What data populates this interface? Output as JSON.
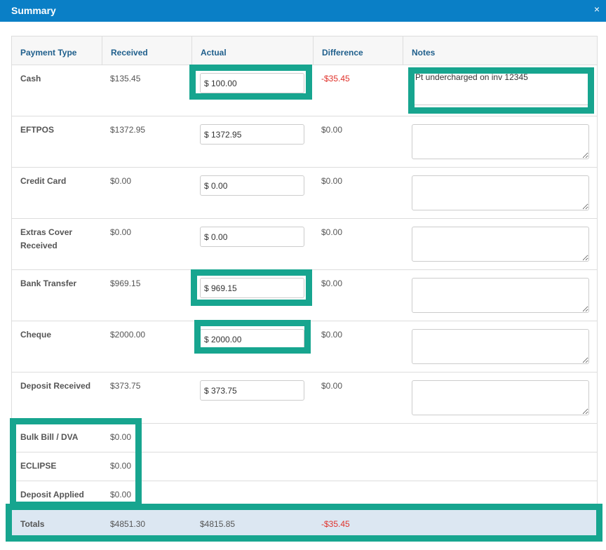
{
  "window": {
    "title": "Summary",
    "close_symbol": "×"
  },
  "columns": {
    "payment_type": "Payment Type",
    "received": "Received",
    "actual": "Actual",
    "difference": "Difference",
    "notes": "Notes"
  },
  "rows": [
    {
      "type": "Cash",
      "received": "$135.45",
      "actual": "$ 100.00",
      "difference": "-$35.45",
      "notes": "Pt undercharged on inv 12345"
    },
    {
      "type": "EFTPOS",
      "received": "$1372.95",
      "actual": "$ 1372.95",
      "difference": "$0.00",
      "notes": ""
    },
    {
      "type": "Credit Card",
      "received": "$0.00",
      "actual": "$ 0.00",
      "difference": "$0.00",
      "notes": ""
    },
    {
      "type": "Extras Cover Received",
      "received": "$0.00",
      "actual": "$ 0.00",
      "difference": "$0.00",
      "notes": ""
    },
    {
      "type": "Bank Transfer",
      "received": "$969.15",
      "actual": "$ 969.15",
      "difference": "$0.00",
      "notes": ""
    },
    {
      "type": "Cheque",
      "received": "$2000.00",
      "actual": "$ 2000.00",
      "difference": "$0.00",
      "notes": ""
    },
    {
      "type": "Deposit Received",
      "received": "$373.75",
      "actual": "$ 373.75",
      "difference": "$0.00",
      "notes": ""
    }
  ],
  "simple_rows": [
    {
      "type": "Bulk Bill / DVA",
      "received": "$0.00"
    },
    {
      "type": "ECLIPSE",
      "received": "$0.00"
    },
    {
      "type": "Deposit Applied",
      "received": "$0.00"
    }
  ],
  "totals": {
    "label": "Totals",
    "received": "$4851.30",
    "actual": "$4815.85",
    "difference": "-$35.45"
  },
  "colors": {
    "title_bar": "#0a7fc6",
    "header_text": "#1f5f8c",
    "negative": "#e0322b",
    "highlight": "#17a58f",
    "totals_bg": "#dce7f2"
  }
}
